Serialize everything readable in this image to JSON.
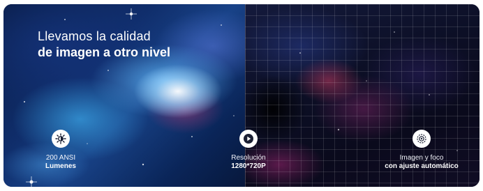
{
  "headline": {
    "line1": "Llevamos la calidad",
    "line2": "de imagen a otro nivel"
  },
  "features": [
    {
      "icon": "brightness-icon",
      "line1": "200 ANSI",
      "line2": "Lumenes"
    },
    {
      "icon": "play-icon",
      "line1": "Resolución",
      "line2": "1280*720P"
    },
    {
      "icon": "auto-focus-icon",
      "line1": "Imagen y foco",
      "line2": "con ajuste automático"
    }
  ],
  "colors": {
    "text": "#ffffff",
    "icon_background": "#ffffff",
    "icon_glyph": "#1a1f33",
    "left_nebula": "#1d4f9e",
    "right_nebula": "#0c0f26"
  }
}
